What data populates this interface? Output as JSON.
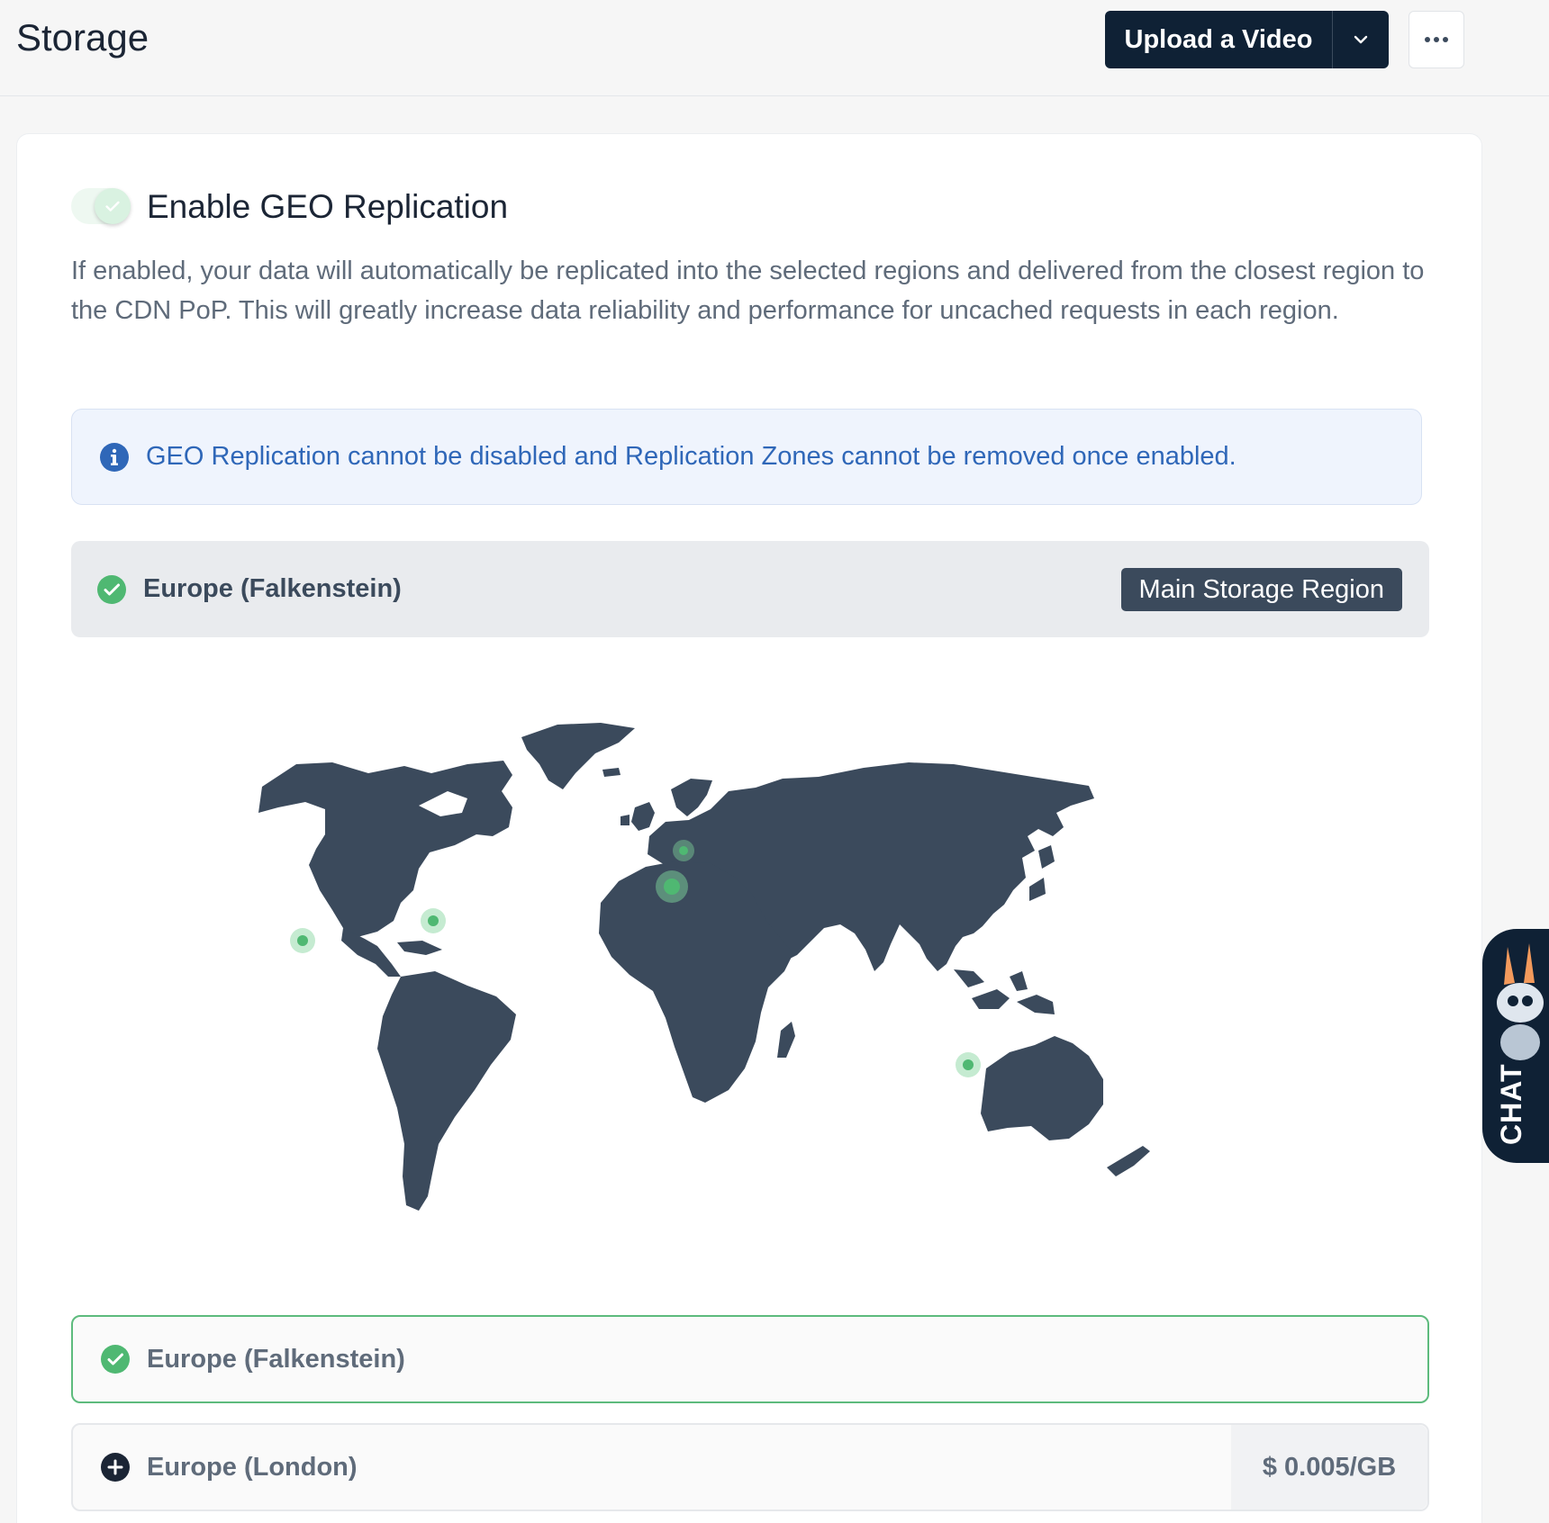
{
  "header": {
    "title": "Storage",
    "upload_label": "Upload a Video",
    "caret_icon": "chevron-down-icon",
    "more_icon": "more-horizontal-icon"
  },
  "geo": {
    "toggle_enabled": true,
    "title": "Enable GEO Replication",
    "description": "If enabled, your data will automatically be replicated into the selected regions and delivered from the closest region to the CDN PoP. This will greatly increase data reliability and performance for uncached requests in each region.",
    "info": "GEO Replication cannot be disabled and Replication Zones cannot be removed once enabled."
  },
  "main_region": {
    "name": "Europe (Falkenstein)",
    "badge": "Main Storage Region"
  },
  "regions": [
    {
      "name": "Europe (Falkenstein)",
      "state": "selected"
    },
    {
      "name": "Europe (London)",
      "state": "addable",
      "price": "$ 0.005/GB"
    }
  ],
  "chat": {
    "label": "CHAT"
  },
  "colors": {
    "primary_dark": "#0f2135",
    "map_land": "#3b4a5c",
    "success_green": "#4fb872",
    "info_blue": "#2f67b8"
  }
}
